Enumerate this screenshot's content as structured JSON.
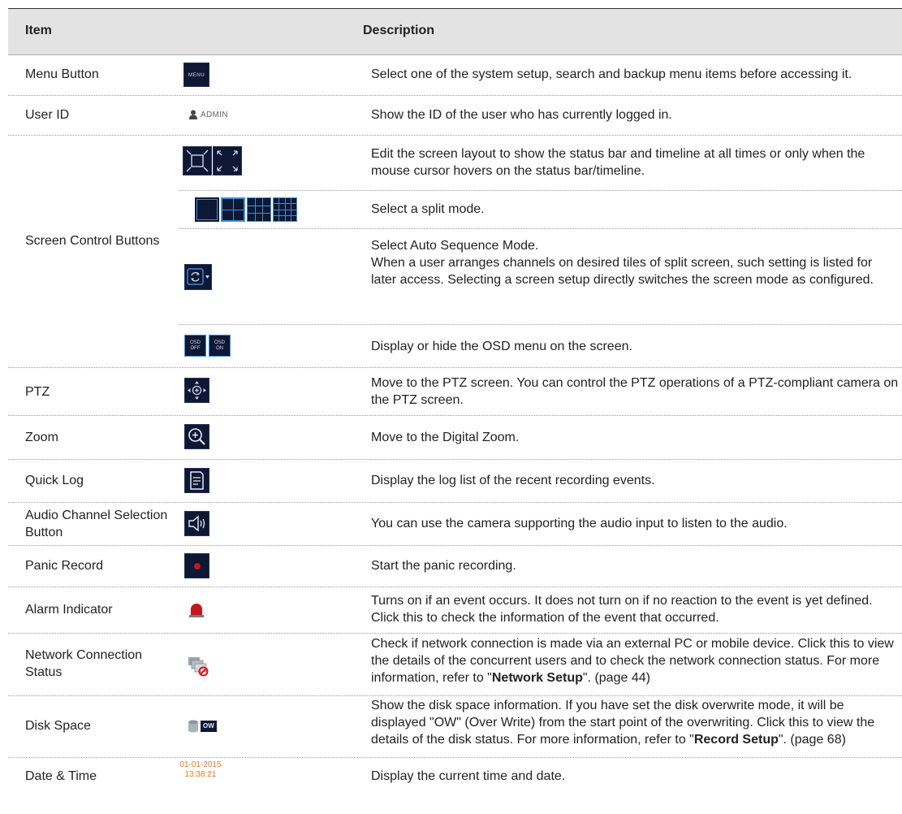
{
  "header": {
    "item": "Item",
    "description": "Description"
  },
  "rows": [
    {
      "name": "Menu Button",
      "icon_text": "MENU",
      "desc": "Select one of the system setup, search and backup menu items before accessing it."
    },
    {
      "name": "User ID",
      "icon_text": "ADMIN",
      "desc": "Show the ID of the user who has currently logged in."
    },
    {
      "name": "Screen Control Buttons",
      "subs": [
        {
          "desc": "Edit the screen layout to show the status bar and timeline at all times or only when the mouse cursor hovers on the status bar/timeline."
        },
        {
          "desc": "Select a split mode."
        },
        {
          "desc": "Select Auto Sequence Mode.\nWhen a user arranges channels on desired tiles of split screen, such setting is listed for later access. Selecting a screen setup directly switches the screen mode as configured."
        },
        {
          "desc": "Display or hide the OSD menu on the screen.",
          "osd_off": [
            "OSD",
            "OFF"
          ],
          "osd_on": [
            "OSD",
            "ON"
          ]
        }
      ]
    },
    {
      "name": "PTZ",
      "desc": "Move to the PTZ screen. You can control the PTZ operations of a PTZ-compliant camera on the PTZ screen."
    },
    {
      "name": "Zoom",
      "desc": "Move to the Digital Zoom."
    },
    {
      "name": "Quick Log",
      "desc": "Display the log list of the recent recording events."
    },
    {
      "name": "Audio Channel Selection Button",
      "desc": "You can use the camera supporting the audio input to listen to the audio."
    },
    {
      "name": "Panic Record",
      "desc": "Start the panic recording."
    },
    {
      "name": "Alarm Indicator",
      "desc": "Turns on if an event occurs. It does not turn on if no reaction to the event is yet defined. Click this to check the information of the event that occurred."
    },
    {
      "name": "Network Connection Status",
      "desc_pre": "Check if network connection is made via an external PC or mobile device. Click this to view the details of the concurrent users and to check the network connection status. For more information, refer to \"",
      "desc_bold": "Network Setup",
      "desc_post": "\". (page 44)"
    },
    {
      "name": "Disk Space",
      "icon_text": "OW",
      "desc_pre": "Show the disk space information. If you have set the disk overwrite mode, it will be displayed \"OW\" (Over Write) from the start point of the overwriting. Click this to view the details of the disk status. For more information, refer to \"",
      "desc_bold": "Record Setup",
      "desc_post": "\". (page 68)"
    },
    {
      "name": "Date & Time",
      "date": "01-01-2015",
      "time": "13:38:21",
      "desc": "Display the current time and date."
    }
  ],
  "colors": {
    "icon_bg": "#0e1733",
    "icon_accent": "#3b8fd8",
    "alarm_red": "#c4161c",
    "date_orange": "#e07b1e"
  }
}
